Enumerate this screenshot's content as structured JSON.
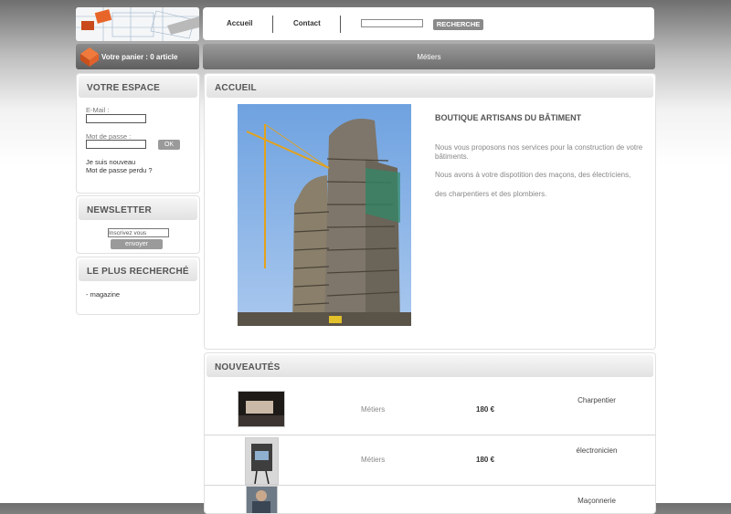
{
  "header": {
    "nav": [
      {
        "label": "Accueil"
      },
      {
        "label": "Contact"
      }
    ],
    "search": {
      "value": "",
      "button_label": "RECHERCHE"
    }
  },
  "cart": {
    "label": "Votre panier : 0 article"
  },
  "category_bar": {
    "label": "Métiers"
  },
  "sidebar": {
    "espace": {
      "title": "VOTRE ESPACE",
      "email_label": "E-Mail :",
      "password_label": "Mot de passe :",
      "ok_label": "OK",
      "links": [
        "Je suis nouveau",
        "Mot de passe perdu ?"
      ]
    },
    "newsletter": {
      "title": "NEWSLETTER",
      "input_value": "Inscrivez vous",
      "button_label": "envoyer"
    },
    "popular": {
      "title": "LE PLUS RECHERCHÉ",
      "items": [
        "- magazine"
      ]
    }
  },
  "accueil": {
    "title": "ACCUEIL",
    "heading": "BOUTIQUE ARTISANS DU BÂTIMENT",
    "paragraph1": "Nous vous proposons nos services pour la construction de votre bâtiments.",
    "paragraph2a": "Nous avons à votre dispotition des maçons, des électriciens,",
    "paragraph2b": "des charpentiers et des plombiers."
  },
  "nouveautes": {
    "title": "NOUVEAUTÉS",
    "products": [
      {
        "category": "Métiers",
        "price": "180 €",
        "name": "Charpentier"
      },
      {
        "category": "Métiers",
        "price": "180 €",
        "name": "électronicien"
      },
      {
        "category": "",
        "price": "",
        "name": "Maçonnerie"
      }
    ]
  }
}
